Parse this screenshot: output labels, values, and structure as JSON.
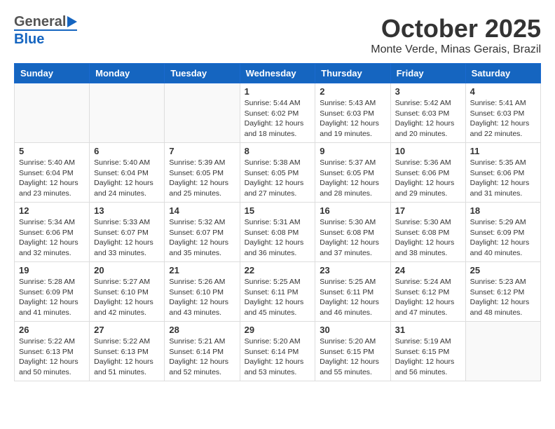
{
  "header": {
    "logo_general": "General",
    "logo_blue": "Blue",
    "month": "October 2025",
    "location": "Monte Verde, Minas Gerais, Brazil"
  },
  "days_of_week": [
    "Sunday",
    "Monday",
    "Tuesday",
    "Wednesday",
    "Thursday",
    "Friday",
    "Saturday"
  ],
  "weeks": [
    [
      {
        "day": "",
        "info": ""
      },
      {
        "day": "",
        "info": ""
      },
      {
        "day": "",
        "info": ""
      },
      {
        "day": "1",
        "info": "Sunrise: 5:44 AM\nSunset: 6:02 PM\nDaylight: 12 hours and 18 minutes."
      },
      {
        "day": "2",
        "info": "Sunrise: 5:43 AM\nSunset: 6:03 PM\nDaylight: 12 hours and 19 minutes."
      },
      {
        "day": "3",
        "info": "Sunrise: 5:42 AM\nSunset: 6:03 PM\nDaylight: 12 hours and 20 minutes."
      },
      {
        "day": "4",
        "info": "Sunrise: 5:41 AM\nSunset: 6:03 PM\nDaylight: 12 hours and 22 minutes."
      }
    ],
    [
      {
        "day": "5",
        "info": "Sunrise: 5:40 AM\nSunset: 6:04 PM\nDaylight: 12 hours and 23 minutes."
      },
      {
        "day": "6",
        "info": "Sunrise: 5:40 AM\nSunset: 6:04 PM\nDaylight: 12 hours and 24 minutes."
      },
      {
        "day": "7",
        "info": "Sunrise: 5:39 AM\nSunset: 6:05 PM\nDaylight: 12 hours and 25 minutes."
      },
      {
        "day": "8",
        "info": "Sunrise: 5:38 AM\nSunset: 6:05 PM\nDaylight: 12 hours and 27 minutes."
      },
      {
        "day": "9",
        "info": "Sunrise: 5:37 AM\nSunset: 6:05 PM\nDaylight: 12 hours and 28 minutes."
      },
      {
        "day": "10",
        "info": "Sunrise: 5:36 AM\nSunset: 6:06 PM\nDaylight: 12 hours and 29 minutes."
      },
      {
        "day": "11",
        "info": "Sunrise: 5:35 AM\nSunset: 6:06 PM\nDaylight: 12 hours and 31 minutes."
      }
    ],
    [
      {
        "day": "12",
        "info": "Sunrise: 5:34 AM\nSunset: 6:06 PM\nDaylight: 12 hours and 32 minutes."
      },
      {
        "day": "13",
        "info": "Sunrise: 5:33 AM\nSunset: 6:07 PM\nDaylight: 12 hours and 33 minutes."
      },
      {
        "day": "14",
        "info": "Sunrise: 5:32 AM\nSunset: 6:07 PM\nDaylight: 12 hours and 35 minutes."
      },
      {
        "day": "15",
        "info": "Sunrise: 5:31 AM\nSunset: 6:08 PM\nDaylight: 12 hours and 36 minutes."
      },
      {
        "day": "16",
        "info": "Sunrise: 5:30 AM\nSunset: 6:08 PM\nDaylight: 12 hours and 37 minutes."
      },
      {
        "day": "17",
        "info": "Sunrise: 5:30 AM\nSunset: 6:08 PM\nDaylight: 12 hours and 38 minutes."
      },
      {
        "day": "18",
        "info": "Sunrise: 5:29 AM\nSunset: 6:09 PM\nDaylight: 12 hours and 40 minutes."
      }
    ],
    [
      {
        "day": "19",
        "info": "Sunrise: 5:28 AM\nSunset: 6:09 PM\nDaylight: 12 hours and 41 minutes."
      },
      {
        "day": "20",
        "info": "Sunrise: 5:27 AM\nSunset: 6:10 PM\nDaylight: 12 hours and 42 minutes."
      },
      {
        "day": "21",
        "info": "Sunrise: 5:26 AM\nSunset: 6:10 PM\nDaylight: 12 hours and 43 minutes."
      },
      {
        "day": "22",
        "info": "Sunrise: 5:25 AM\nSunset: 6:11 PM\nDaylight: 12 hours and 45 minutes."
      },
      {
        "day": "23",
        "info": "Sunrise: 5:25 AM\nSunset: 6:11 PM\nDaylight: 12 hours and 46 minutes."
      },
      {
        "day": "24",
        "info": "Sunrise: 5:24 AM\nSunset: 6:12 PM\nDaylight: 12 hours and 47 minutes."
      },
      {
        "day": "25",
        "info": "Sunrise: 5:23 AM\nSunset: 6:12 PM\nDaylight: 12 hours and 48 minutes."
      }
    ],
    [
      {
        "day": "26",
        "info": "Sunrise: 5:22 AM\nSunset: 6:13 PM\nDaylight: 12 hours and 50 minutes."
      },
      {
        "day": "27",
        "info": "Sunrise: 5:22 AM\nSunset: 6:13 PM\nDaylight: 12 hours and 51 minutes."
      },
      {
        "day": "28",
        "info": "Sunrise: 5:21 AM\nSunset: 6:14 PM\nDaylight: 12 hours and 52 minutes."
      },
      {
        "day": "29",
        "info": "Sunrise: 5:20 AM\nSunset: 6:14 PM\nDaylight: 12 hours and 53 minutes."
      },
      {
        "day": "30",
        "info": "Sunrise: 5:20 AM\nSunset: 6:15 PM\nDaylight: 12 hours and 55 minutes."
      },
      {
        "day": "31",
        "info": "Sunrise: 5:19 AM\nSunset: 6:15 PM\nDaylight: 12 hours and 56 minutes."
      },
      {
        "day": "",
        "info": ""
      }
    ]
  ]
}
